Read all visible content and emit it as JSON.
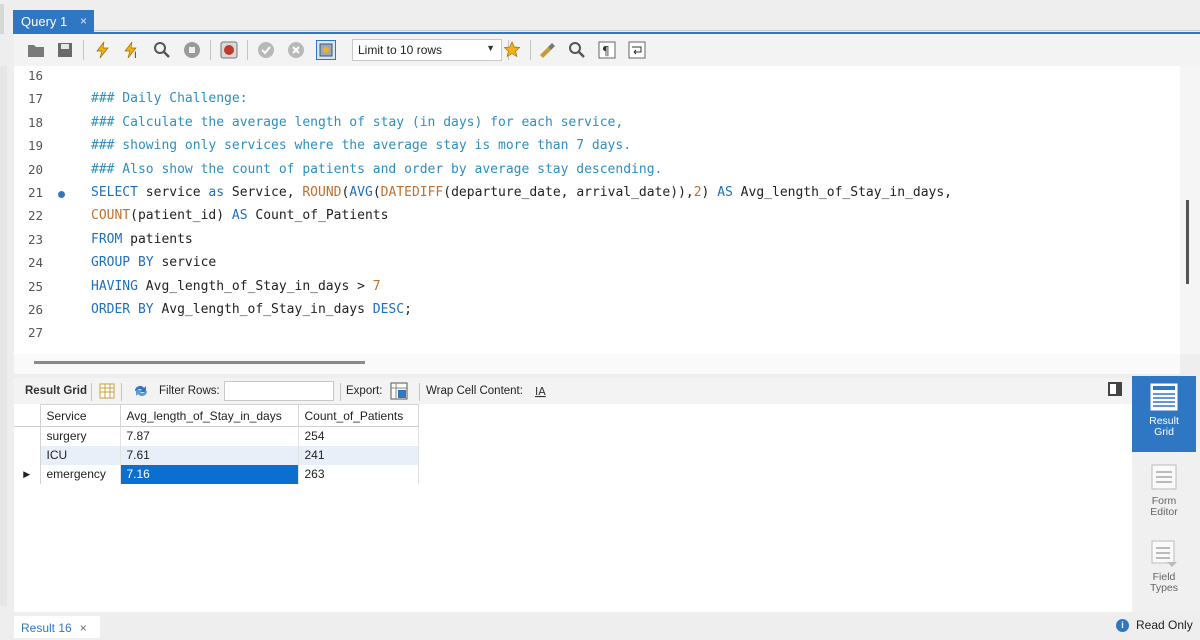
{
  "tab": {
    "title": "Query 1",
    "close": "×"
  },
  "toolbar": {
    "limit_select": "Limit to 10 rows",
    "icons": [
      "open-folder-icon",
      "save-icon",
      "execute-icon",
      "execute-current-icon",
      "explain-icon",
      "stop-icon",
      "toggle-error-icon",
      "commit-icon",
      "rollback-icon",
      "autocommit-icon",
      "bookmark-star-icon",
      "beautify-icon",
      "find-icon",
      "invisible-chars-icon",
      "wrap-icon"
    ]
  },
  "editor": {
    "lines": [
      {
        "n": "16",
        "code": ""
      },
      {
        "n": "17",
        "code": "### Daily Challenge:"
      },
      {
        "n": "18",
        "code": "### Calculate the average length of stay (in days) for each service,"
      },
      {
        "n": "19",
        "code": "### showing only services where the average stay is more than 7 days."
      },
      {
        "n": "20",
        "code": "### Also show the count of patients and order by average stay descending."
      },
      {
        "n": "21",
        "code": "SELECT service as Service, ROUND(AVG(DATEDIFF(departure_date, arrival_date)),2) AS Avg_length_of_Stay_in_days,"
      },
      {
        "n": "22",
        "code": "COUNT(patient_id) AS Count_of_Patients"
      },
      {
        "n": "23",
        "code": "FROM patients"
      },
      {
        "n": "24",
        "code": "GROUP BY service"
      },
      {
        "n": "25",
        "code": "HAVING Avg_length_of_Stay_in_days > 7"
      },
      {
        "n": "26",
        "code": "ORDER BY Avg_length_of_Stay_in_days DESC;"
      },
      {
        "n": "27",
        "code": ""
      }
    ],
    "active_line": "21"
  },
  "result_toolbar": {
    "result_grid": "Result Grid",
    "filter_rows": "Filter Rows:",
    "export": "Export:",
    "wrap_cell": "Wrap Cell Content:"
  },
  "grid": {
    "columns": [
      "Service",
      "Avg_length_of_Stay_in_days",
      "Count_of_Patients"
    ],
    "rows": [
      [
        "surgery",
        "7.87",
        "254"
      ],
      [
        "ICU",
        "7.61",
        "241"
      ],
      [
        "emergency",
        "7.16",
        "263"
      ]
    ]
  },
  "side_panel": {
    "result_grid": [
      "Result",
      "Grid"
    ],
    "form_editor": [
      "Form",
      "Editor"
    ],
    "field_types": [
      "Field",
      "Types"
    ]
  },
  "status": {
    "result_tab": "Result 16",
    "close": "×",
    "read_only": "Read Only"
  },
  "colors": {
    "accent": "#2f77c3",
    "selection": "#0a6fcf",
    "comment": "#2e8fc0"
  }
}
